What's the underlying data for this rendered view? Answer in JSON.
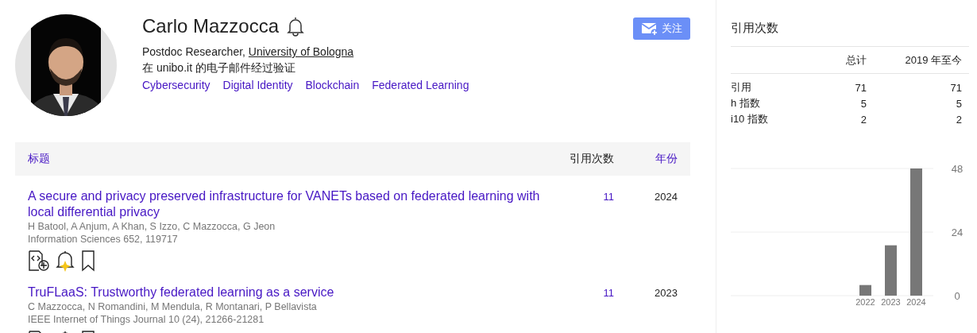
{
  "profile": {
    "name": "Carlo Mazzocca",
    "affiliation_prefix": "Postdoc Researcher, ",
    "affiliation_link": "University of Bologna",
    "verified": "在 unibo.it 的电子邮件经过验证",
    "interests": [
      "Cybersecurity",
      "Digital Identity",
      "Blockchain",
      "Federated Learning"
    ],
    "follow_button": "关注"
  },
  "articles_header": {
    "title": "标题",
    "cited_by": "引用次数",
    "year": "年份"
  },
  "articles": [
    {
      "title": "A secure and privacy preserved infrastructure for VANETs based on federated learning with local differential privacy",
      "authors": "H Batool, A Anjum, A Khan, S Izzo, C Mazzocca, G Jeon",
      "venue": "Information Sciences 652, 119717",
      "citations": "11",
      "year": "2024"
    },
    {
      "title": "TruFLaaS: Trustworthy federated learning as a service",
      "authors": "C Mazzocca, N Romandini, M Mendula, R Montanari, P Bellavista",
      "venue": "IEEE Internet of Things Journal 10 (24), 21266-21281",
      "citations": "11",
      "year": "2023"
    }
  ],
  "citations_panel": {
    "title": "引用次数",
    "columns": [
      "总计",
      "2019 年至今"
    ],
    "rows": [
      {
        "label": "引用",
        "all": "71",
        "since": "71"
      },
      {
        "label": "h 指数",
        "all": "5",
        "since": "5"
      },
      {
        "label": "i10 指数",
        "all": "2",
        "since": "2"
      }
    ],
    "chart_data": {
      "type": "bar",
      "categories": [
        "2022",
        "2023",
        "2024"
      ],
      "values": [
        4,
        19,
        48
      ],
      "ylim": [
        0,
        48
      ],
      "yticks": [
        0,
        24,
        48
      ]
    }
  }
}
